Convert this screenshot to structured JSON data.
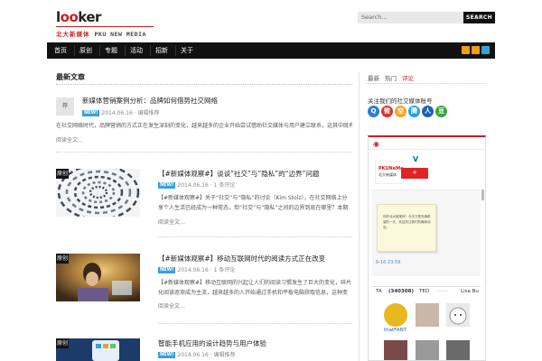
{
  "header": {
    "logo_prefix": "l",
    "logo_o1": "o",
    "logo_o2": "o",
    "logo_suffix": "ker",
    "logo_cn": "北大新媒体",
    "logo_en": "PKU NEW MEDIA",
    "search_placeholder": "Search...",
    "search_button": "SEARCH"
  },
  "nav": {
    "items": [
      "首页",
      "原创",
      "专题",
      "活动",
      "招新",
      "关于"
    ]
  },
  "page": {
    "title": "最新文章"
  },
  "posts": [
    {
      "tag": "荐",
      "title": "新媒体营销案例分析：品牌如何借势社交网络",
      "badge": "NEW!",
      "meta": "2014.06.16 · 编辑推荐",
      "excerpt": "在社交网络时代，品牌营销的方式正在发生深刻的变化，越来越多的企业开始尝试借助社交媒体与用户建立联系，这其中既有成功的经验，也有失败的教训，本文以PayPal、Facebook等为例进行分析……",
      "more": "阅读全文…"
    },
    {
      "tag": "原创",
      "title": "【#新媒体观察#】谈谈“社交”与“隐私”的“边界”问题",
      "badge": "NEW!",
      "meta": "2014.06.16 · 1 条评论",
      "excerpt": "【#新媒体观察#】关于“社交”与“隐私”的讨论（Kim Stolz），在社交网络上分享个人生活已经成为一种常态，但“社交”与“隐私”之间的边界到底在哪里？本期我们从SNS的角度出发，聊聊用户隐私保护的问题……",
      "more": "阅读全文…"
    },
    {
      "tag": "原创",
      "title": "【#新媒体观察#】移动互联网时代的阅读方式正在改变",
      "badge": "NEW!",
      "meta": "2014.06.16 · 1 条评论",
      "excerpt": "【#新媒体观察#】移动互联网的兴起让人们的阅读习惯发生了巨大的变化，碎片化阅读逐渐成为主流，越来越多的人开始通过手机和平板电脑获取信息，这种变化对传统媒体带来了前所未有的挑战，也带来了新的机遇……",
      "more": "阅读全文…"
    },
    {
      "tag": "原创",
      "title": "智能手机应用的设计趋势与用户体验",
      "badge": "NEW!",
      "meta": "2014.06.16 · 编辑推荐"
    }
  ],
  "sidebar": {
    "tabs": [
      "最新",
      "热门",
      "评论"
    ],
    "active_tab": 2,
    "follow_label": "关注我们的社交媒体账号",
    "social": [
      {
        "icon": "qq-icon",
        "glyph": "Q",
        "color": "#2a7fd4"
      },
      {
        "icon": "weibo-icon",
        "glyph": "微",
        "color": "#e0332a"
      },
      {
        "icon": "qzone-icon",
        "glyph": "空",
        "color": "#f5a623"
      },
      {
        "icon": "tencent-weibo-icon",
        "glyph": "腾",
        "color": "#2aa0d8"
      },
      {
        "icon": "renren-icon",
        "glyph": "人",
        "color": "#1e62b4"
      },
      {
        "icon": "douban-icon",
        "glyph": "豆",
        "color": "#3aa33a"
      }
    ],
    "weibo": {
      "avatar_line1": "PKUNeMe",
      "avatar_line2": "北大新媒体",
      "v_mark": "V",
      "follow": "+",
      "card_text": "你好北大新媒体！今天又是充满希望的一天，欢迎关注我们的最新动态。",
      "time": "6-16 23:59",
      "stats": [
        "TA",
        "(340308)",
        "TED",
        "------",
        "Lisa Bu"
      ],
      "fan_names": [
        "thatFANT",
        "",
        ""
      ]
    }
  }
}
